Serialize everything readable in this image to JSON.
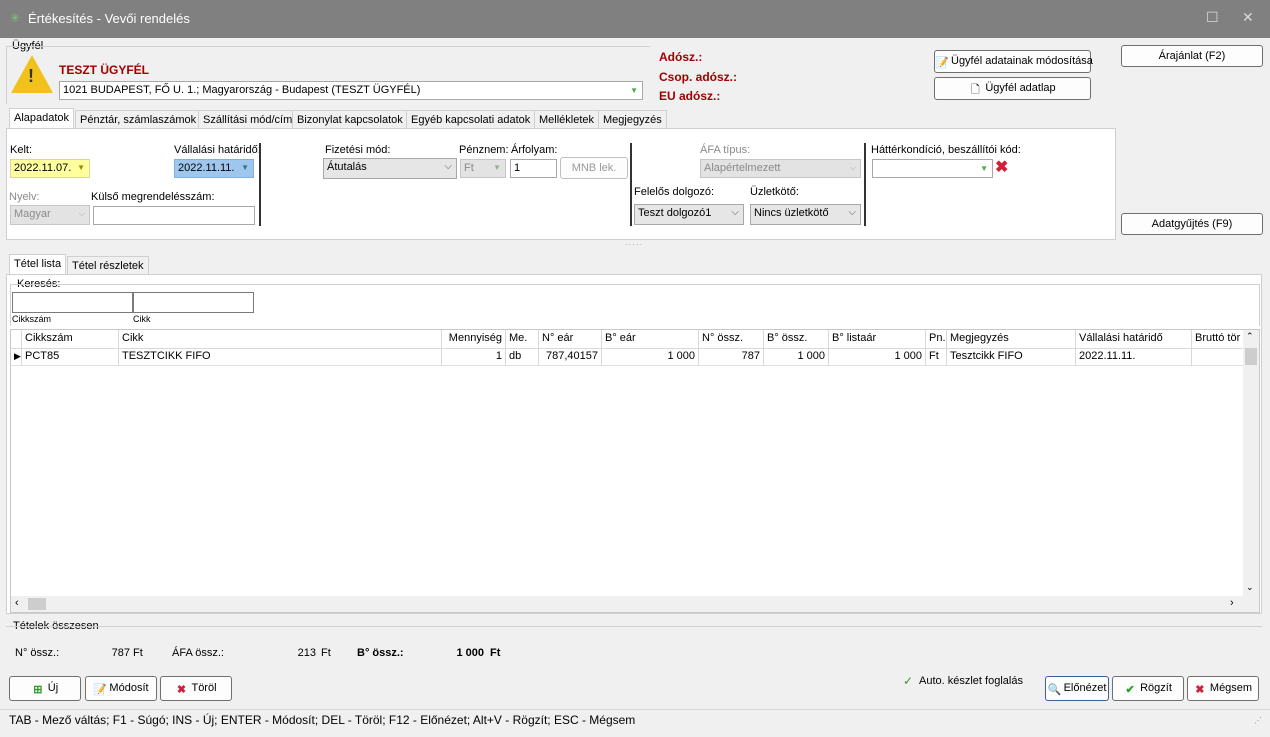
{
  "window": {
    "title": "Értékesítés - Vevői rendelés"
  },
  "customer": {
    "group_label": "Ügyfél",
    "name": "TESZT ÜGYFÉL",
    "address": "1021 BUDAPEST, FŐ U. 1.; Magyarország - Budapest (TESZT ÜGYFÉL)",
    "tax_label": "Adósz.:",
    "group_tax_label": "Csop. adósz.:",
    "eu_tax_label": "EU adósz.:",
    "modify_button": "Ügyfél adatainak módosítása",
    "datasheet_button": "Ügyfél adatlap"
  },
  "side_buttons": {
    "quote": "Árajánlat (F2)",
    "collect": "Adatgyűjtés (F9)"
  },
  "tabs": [
    "Alapadatok",
    "Pénztár, számlaszámok",
    "Szállítási mód/cím",
    "Bizonylat kapcsolatok",
    "Egyéb kapcsolati adatok",
    "Mellékletek",
    "Megjegyzés"
  ],
  "form": {
    "kelt_label": "Kelt:",
    "kelt_value": "2022.11.07.",
    "deadline_label": "Vállalási határidő:",
    "deadline_value": "2022.11.11.",
    "payment_label": "Fizetési mód:",
    "payment_value": "Átutalás",
    "currency_label": "Pénznem:",
    "currency_value": "Ft",
    "rate_label": "Árfolyam:",
    "rate_value": "1",
    "mnb_button": "MNB lek.",
    "vat_type_label": "ÁFA típus:",
    "vat_type_value": "Alapértelmezett",
    "background_label": "Háttérkondíció, beszállítói kód:",
    "background_value": "",
    "language_label": "Nyelv:",
    "language_value": "Magyar",
    "ext_order_label": "Külső megrendelésszám:",
    "ext_order_value": "",
    "responsible_label": "Felelős dolgozó:",
    "responsible_value": "Teszt dolgozó1",
    "agent_label": "Üzletkötő:",
    "agent_value": "Nincs üzletkötő"
  },
  "item_tabs": [
    "Tétel lista",
    "Tétel részletek"
  ],
  "search": {
    "label": "Keresés:",
    "code_label": "Cikkszám",
    "item_label": "Cikk"
  },
  "table": {
    "columns": [
      "Cikkszám",
      "Cikk",
      "Mennyiség",
      "Me.",
      "N° eár",
      "B° eár",
      "N° össz.",
      "B° össz.",
      "B° listaár",
      "Pn.",
      "Megjegyzés",
      "Vállalási határidő",
      "Bruttó tör"
    ],
    "rows": [
      [
        "PCT85",
        "TESZTCIKK FIFO",
        "1",
        "db",
        "787,40157",
        "1 000",
        "787",
        "1 000",
        "1 000",
        "Ft",
        "Tesztcikk FIFO",
        "2022.11.11.",
        ""
      ]
    ]
  },
  "totals": {
    "title": "Tételek összesen",
    "net_label": "N° össz.:",
    "net_value": "787",
    "net_cur": "Ft",
    "vat_label": "ÁFA össz.:",
    "vat_value": "213",
    "vat_cur": "Ft",
    "gross_label": "B° össz.:",
    "gross_value": "1 000",
    "gross_cur": "Ft"
  },
  "bottom": {
    "new": "Új",
    "modify": "Módosít",
    "delete": "Töröl",
    "auto_reserve": "Auto. készlet foglalás",
    "preview": "Előnézet",
    "save": "Rögzít",
    "cancel": "Mégsem"
  },
  "statusbar": "TAB - Mező váltás; F1 - Súgó; INS - Új; ENTER - Módosít; DEL - Töröl; F12 - Előnézet; Alt+V - Rögzít; ESC - Mégsem"
}
